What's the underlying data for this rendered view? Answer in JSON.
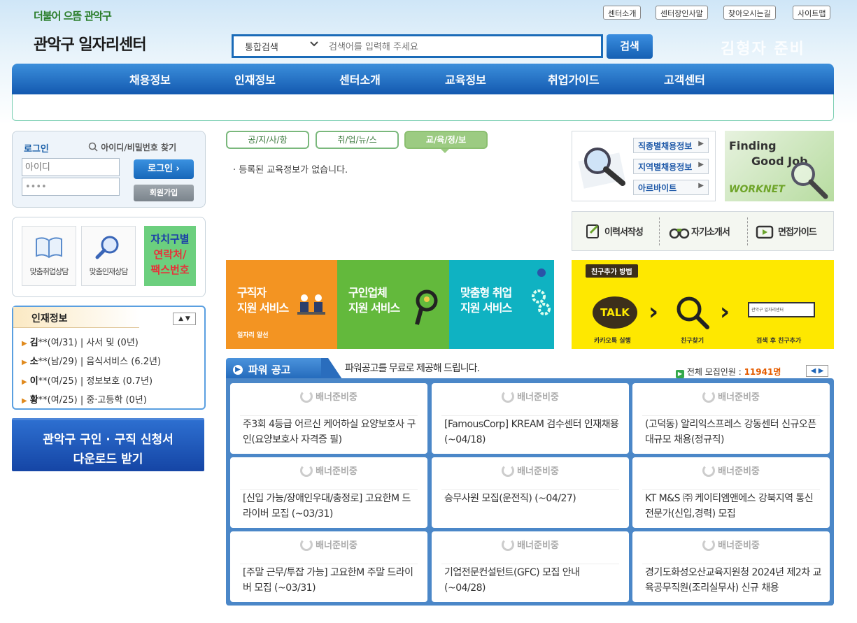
{
  "header": {
    "slogan": "더불어 으뜸 관악구",
    "site_title": "관악구 일자리센터",
    "campaign": "김형자 준비",
    "util_links": [
      "센터소개",
      "센터장인사말",
      "찾아오시는길",
      "사이트맵"
    ]
  },
  "search": {
    "category": "통합검색",
    "placeholder": "검색어를 입력해 주세요",
    "button": "검색"
  },
  "nav": {
    "items": [
      "채용정보",
      "인재정보",
      "센터소개",
      "교육정보",
      "취업가이드",
      "고객센터"
    ]
  },
  "login": {
    "title": "로그인",
    "find_link": "아이디/비밀번호 찾기",
    "id_placeholder": "아이디",
    "pw_value": "••••",
    "login_button": "로그인 ›",
    "join_button": "회원가입"
  },
  "quick": {
    "items": [
      "맞춤취업상담",
      "맞춤인재상담"
    ],
    "contact_line1": "자치구별",
    "contact_line2": "연락처/",
    "contact_line3": "팩스번호"
  },
  "talent": {
    "title": "인재정보",
    "rows": [
      {
        "name": "김",
        "info": "**(여/31) | 사서 및 (0년)"
      },
      {
        "name": "소",
        "info": "**(남/29) | 음식서비스 (6.2년)"
      },
      {
        "name": "이",
        "info": "**(여/25) | 정보보호 (0.7년)"
      },
      {
        "name": "황",
        "info": "**(여/25) | 중·고등학 (0년)"
      }
    ]
  },
  "download": {
    "line1": "관악구 구인 · 구직 신청서",
    "line2": "다운로드 받기"
  },
  "tabs": {
    "items": [
      "공/지/사/항",
      "취/업/뉴/스",
      "교/육/정/보"
    ],
    "active_index": 2,
    "empty_message": "· 등록된 교육정보가 없습니다."
  },
  "services": [
    {
      "line1": "구직자",
      "line2": "지원 서비스",
      "sub": "일자리 알선",
      "color": "#f39422"
    },
    {
      "line1": "구인업체",
      "line2": "지원 서비스",
      "sub": "",
      "color": "#63b93c"
    },
    {
      "line1": "맞춤형 취업",
      "line2": "지원 서비스",
      "sub": "",
      "color": "#0fb2c2"
    }
  ],
  "job_links": {
    "items": [
      "직종별채용정보",
      "지역별채용정보",
      "아르바이트"
    ]
  },
  "worknet": {
    "line1": "Finding",
    "line2": "Good Job",
    "brand": "WORKNET"
  },
  "guides": {
    "items": [
      "이력서작성",
      "자기소개서",
      "면접가이드"
    ]
  },
  "kakao": {
    "tag": "친구추가 방법",
    "talk": "TALK",
    "search_text": "관악구 일자리센터",
    "captions": [
      "카카오톡 실행",
      "친구찾기",
      "검색 후 친구추가"
    ]
  },
  "power": {
    "title": "파워 공고",
    "subtitle": "파워공고를 무료로 제공해 드립니다.",
    "total_label": "전체 모집인원 :",
    "total_count": "11941명",
    "banner_text": "배너준비중",
    "cards": [
      "주3회 4등급 어르신 케어하실 요양보호사 구인(요양보호사 자격증 필)",
      "[FamousCorp] KREAM 검수센터 인재채용 (~04/18)",
      "(고덕동) 알리익스프레스 강동센터 신규오픈 대규모 채용(정규직)",
      "[신입 가능/장애인우대/충정로] 고요한M 드라이버 모집 (~03/31)",
      "승무사원 모집(운전직) (~04/27)",
      "KT M&S ㈜ 케이티엠앤에스 강북지역 통신전문가(신입,경력) 모집",
      "[주말 근무/투잡 가능] 고요한M 주말 드라이버 모집 (~03/31)",
      "기업전문컨설턴트(GFC) 모집 안내 (~04/28)",
      "경기도화성오산교육지원청 2024년 제2차 교육공무직원(조리실무사) 신규 채용"
    ]
  }
}
